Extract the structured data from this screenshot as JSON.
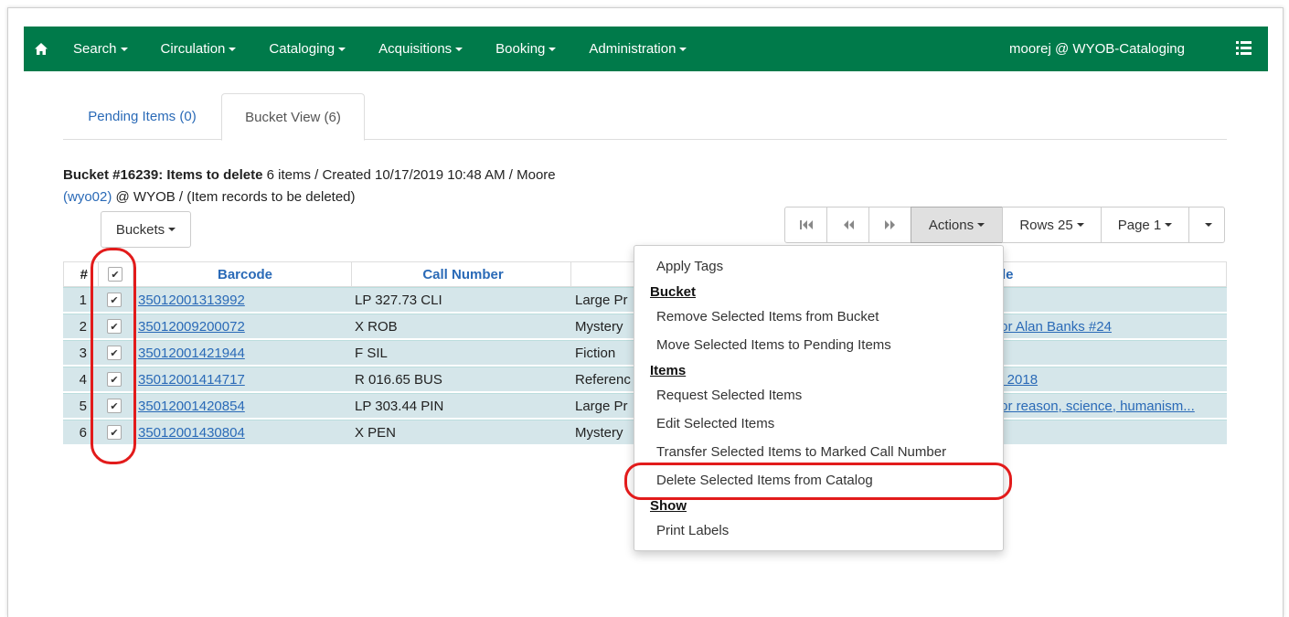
{
  "navbar": {
    "menus": [
      "Search",
      "Circulation",
      "Cataloging",
      "Acquisitions",
      "Booking",
      "Administration"
    ],
    "user": "moorej @ WYOB-Cataloging",
    "bg_color": "#007a4a"
  },
  "tabs": {
    "pending": "Pending Items (0)",
    "bucket": "Bucket View (6)"
  },
  "bucket": {
    "title": "Bucket #16239: Items to delete",
    "summary": " 6 items / Created 10/17/2019 10:48 AM / Moore",
    "owner_link": "(wyo02)",
    "owner_rest": " @ WYOB / (Item records to be deleted)"
  },
  "buckets_button": "Buckets",
  "pager": {
    "actions": "Actions",
    "rows": "Rows 25",
    "page": "Page 1"
  },
  "table": {
    "headers": {
      "num": "#",
      "barcode": "Barcode",
      "call_number": "Call Number",
      "title": "tle"
    },
    "rows": [
      {
        "num": "1",
        "barcode": "35012001313992",
        "call": "LP 327.73 CLI",
        "genre": "Large Pr",
        "title": ""
      },
      {
        "num": "2",
        "barcode": "35012009200072",
        "call": "X ROB",
        "genre": "Mystery",
        "title": "tor Alan Banks #24"
      },
      {
        "num": "3",
        "barcode": "35012001421944",
        "call": "F SIL",
        "genre": "Fiction",
        "title": ""
      },
      {
        "num": "4",
        "barcode": "35012001414717",
        "call": "R 016.65 BUS",
        "genre": "Referenc",
        "title": "s 2018"
      },
      {
        "num": "5",
        "barcode": "35012001420854",
        "call": "LP 303.44 PIN",
        "genre": "Large Pr",
        "title": "for reason, science, humanism..."
      },
      {
        "num": "6",
        "barcode": "35012001430804",
        "call": "X PEN",
        "genre": "Mystery",
        "title": ""
      }
    ]
  },
  "actions_menu": {
    "apply_tags": "Apply Tags",
    "bucket_header": "Bucket",
    "remove": "Remove Selected Items from Bucket",
    "move": "Move Selected Items to Pending Items",
    "items_header": "Items",
    "request": "Request Selected Items",
    "edit": "Edit Selected Items",
    "transfer": "Transfer Selected Items to Marked Call Number",
    "delete": "Delete Selected Items from Catalog",
    "show_header": "Show",
    "print": "Print Labels"
  },
  "annotation_color": "#e21b1b"
}
